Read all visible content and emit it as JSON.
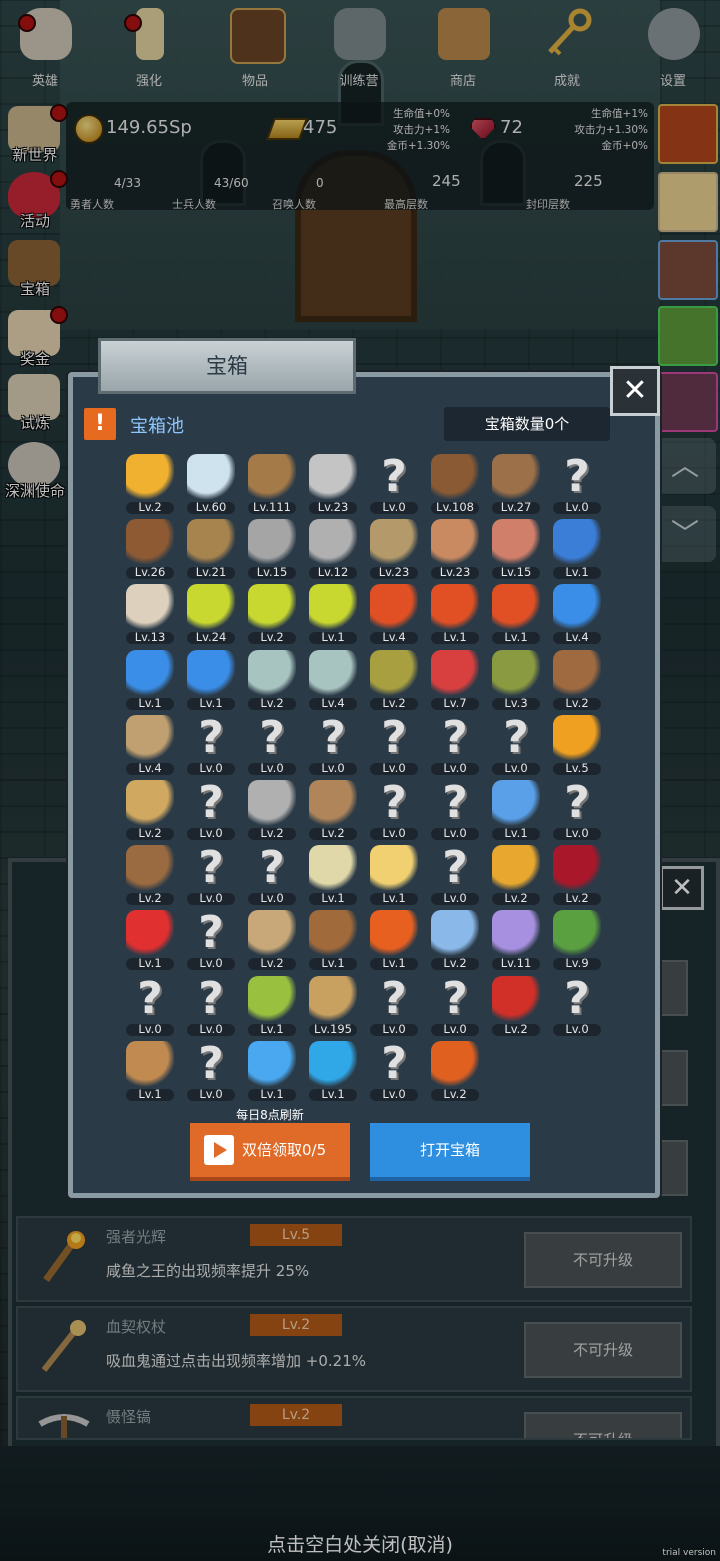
{
  "stats": {
    "coins": "149.65Sp",
    "gold": "475",
    "gems": "72",
    "mid_bonus": [
      "生命值+0%",
      "攻击力+1%",
      "金币+1.30%"
    ],
    "right_bonus": [
      "生命值+1%",
      "攻击力+1.30%",
      "金币+0%"
    ],
    "row2": [
      {
        "value": "4/33",
        "label": "勇者人数"
      },
      {
        "value": "43/60",
        "label": "士兵人数"
      },
      {
        "value": "0",
        "label": "召唤人数"
      },
      {
        "value": "245",
        "label": "最高层数"
      },
      {
        "value": "225",
        "label": "封印层数"
      }
    ]
  },
  "left_nav": [
    "新世界",
    "活动",
    "宝箱",
    "奖金",
    "试炼",
    "深渊使命"
  ],
  "modal": {
    "title": "宝箱",
    "pool_label": "宝箱池",
    "chest_count": "宝箱数量0个",
    "refresh_note": "每日8点刷新",
    "double_button": "双倍领取0/5",
    "open_button": "打开宝箱",
    "items": [
      {
        "icon": "crown-icon",
        "lv": "Lv.2"
      },
      {
        "icon": "diamond-icon",
        "lv": "Lv.60"
      },
      {
        "icon": "wooden-sword-icon",
        "lv": "Lv.111"
      },
      {
        "icon": "steel-sword-icon",
        "lv": "Lv.23"
      },
      {
        "icon": "unknown-icon",
        "lv": "Lv.0"
      },
      {
        "icon": "leather-armor-icon",
        "lv": "Lv.108"
      },
      {
        "icon": "backpack-armor-icon",
        "lv": "Lv.27"
      },
      {
        "icon": "unknown-icon",
        "lv": "Lv.0"
      },
      {
        "icon": "leather-helmet-icon",
        "lv": "Lv.26"
      },
      {
        "icon": "dagger-icon",
        "lv": "Lv.21"
      },
      {
        "icon": "knight-helmet-icon",
        "lv": "Lv.15"
      },
      {
        "icon": "hammer-icon",
        "lv": "Lv.12"
      },
      {
        "icon": "great-helm-icon",
        "lv": "Lv.23"
      },
      {
        "icon": "ham-icon",
        "lv": "Lv.23"
      },
      {
        "icon": "steak-icon",
        "lv": "Lv.15"
      },
      {
        "icon": "blue-pouch-icon",
        "lv": "Lv.1"
      },
      {
        "icon": "flour-sack-icon",
        "lv": "Lv.13"
      },
      {
        "icon": "yellow-potion-icon",
        "lv": "Lv.24"
      },
      {
        "icon": "yellow-potion-icon",
        "lv": "Lv.2"
      },
      {
        "icon": "yellow-potion-icon",
        "lv": "Lv.1"
      },
      {
        "icon": "red-potion-icon",
        "lv": "Lv.4"
      },
      {
        "icon": "red-potion-icon",
        "lv": "Lv.1"
      },
      {
        "icon": "red-potion-icon",
        "lv": "Lv.1"
      },
      {
        "icon": "blue-potion-icon",
        "lv": "Lv.4"
      },
      {
        "icon": "blue-potion-icon",
        "lv": "Lv.1"
      },
      {
        "icon": "blue-potion-icon",
        "lv": "Lv.1"
      },
      {
        "icon": "gray-potion-icon",
        "lv": "Lv.2"
      },
      {
        "icon": "gray-potion-icon",
        "lv": "Lv.4"
      },
      {
        "icon": "olive-bottle-icon",
        "lv": "Lv.2"
      },
      {
        "icon": "red-bottle-icon",
        "lv": "Lv.7"
      },
      {
        "icon": "winged-boot-icon",
        "lv": "Lv.3"
      },
      {
        "icon": "leather-boot-icon",
        "lv": "Lv.2"
      },
      {
        "icon": "cloth-boot-icon",
        "lv": "Lv.4"
      },
      {
        "icon": "unknown-icon",
        "lv": "Lv.0"
      },
      {
        "icon": "unknown-icon",
        "lv": "Lv.0"
      },
      {
        "icon": "unknown-icon",
        "lv": "Lv.0"
      },
      {
        "icon": "unknown-icon",
        "lv": "Lv.0"
      },
      {
        "icon": "unknown-icon",
        "lv": "Lv.0"
      },
      {
        "icon": "unknown-icon",
        "lv": "Lv.0"
      },
      {
        "icon": "torch-icon",
        "lv": "Lv.5"
      },
      {
        "icon": "blood-staff-icon",
        "lv": "Lv.2"
      },
      {
        "icon": "unknown-icon",
        "lv": "Lv.0"
      },
      {
        "icon": "pickaxe-icon",
        "lv": "Lv.2"
      },
      {
        "icon": "crook-staff-icon",
        "lv": "Lv.2"
      },
      {
        "icon": "unknown-icon",
        "lv": "Lv.0"
      },
      {
        "icon": "unknown-icon",
        "lv": "Lv.0"
      },
      {
        "icon": "orb-wand-icon",
        "lv": "Lv.1"
      },
      {
        "icon": "unknown-icon",
        "lv": "Lv.0"
      },
      {
        "icon": "bag-icon",
        "lv": "Lv.2"
      },
      {
        "icon": "unknown-icon",
        "lv": "Lv.0"
      },
      {
        "icon": "unknown-icon",
        "lv": "Lv.0"
      },
      {
        "icon": "bone-club-icon",
        "lv": "Lv.1"
      },
      {
        "icon": "cheese-icon",
        "lv": "Lv.1"
      },
      {
        "icon": "unknown-icon",
        "lv": "Lv.0"
      },
      {
        "icon": "honey-jar-icon",
        "lv": "Lv.2"
      },
      {
        "icon": "dark-crystal-icon",
        "lv": "Lv.2"
      },
      {
        "icon": "red-button-icon",
        "lv": "Lv.1"
      },
      {
        "icon": "unknown-icon",
        "lv": "Lv.0"
      },
      {
        "icon": "bow-icon",
        "lv": "Lv.2"
      },
      {
        "icon": "crossbow-icon",
        "lv": "Lv.1"
      },
      {
        "icon": "flame-crest-icon",
        "lv": "Lv.1"
      },
      {
        "icon": "blue-crest-icon",
        "lv": "Lv.2"
      },
      {
        "icon": "eyes-crest-icon",
        "lv": "Lv.11"
      },
      {
        "icon": "green-emblem-icon",
        "lv": "Lv.9"
      },
      {
        "icon": "unknown-icon",
        "lv": "Lv.0"
      },
      {
        "icon": "unknown-icon",
        "lv": "Lv.0"
      },
      {
        "icon": "green-wand-icon",
        "lv": "Lv.1"
      },
      {
        "icon": "beer-mug-icon",
        "lv": "Lv.195"
      },
      {
        "icon": "unknown-icon",
        "lv": "Lv.0"
      },
      {
        "icon": "unknown-icon",
        "lv": "Lv.0"
      },
      {
        "icon": "red-book-icon",
        "lv": "Lv.2"
      },
      {
        "icon": "unknown-icon",
        "lv": "Lv.0"
      },
      {
        "icon": "whip-icon",
        "lv": "Lv.1"
      },
      {
        "icon": "unknown-icon",
        "lv": "Lv.0"
      },
      {
        "icon": "blue-joystick-icon",
        "lv": "Lv.1"
      },
      {
        "icon": "blue-rune-icon",
        "lv": "Lv.1"
      },
      {
        "icon": "unknown-icon",
        "lv": "Lv.0"
      },
      {
        "icon": "fire-wand-icon",
        "lv": "Lv.2"
      }
    ]
  },
  "upgrades": [
    {
      "title": "强者光辉",
      "level": "Lv.5",
      "desc": "咸鱼之王的出现频率提升 25%",
      "button": "不可升级"
    },
    {
      "title": "血契权杖",
      "level": "Lv.2",
      "desc": "吸血鬼通过点击出现频率增加 +0.21%",
      "button": "不可升级"
    },
    {
      "title": "慑怪镐",
      "level": "Lv.2",
      "desc": "",
      "button": "不可升级"
    }
  ],
  "bottom_nav": [
    "英雄",
    "强化",
    "物品",
    "训练营",
    "商店",
    "成就",
    "设置"
  ],
  "close_hint": "点击空白处关闭(取消)",
  "trial_label": "trial version"
}
